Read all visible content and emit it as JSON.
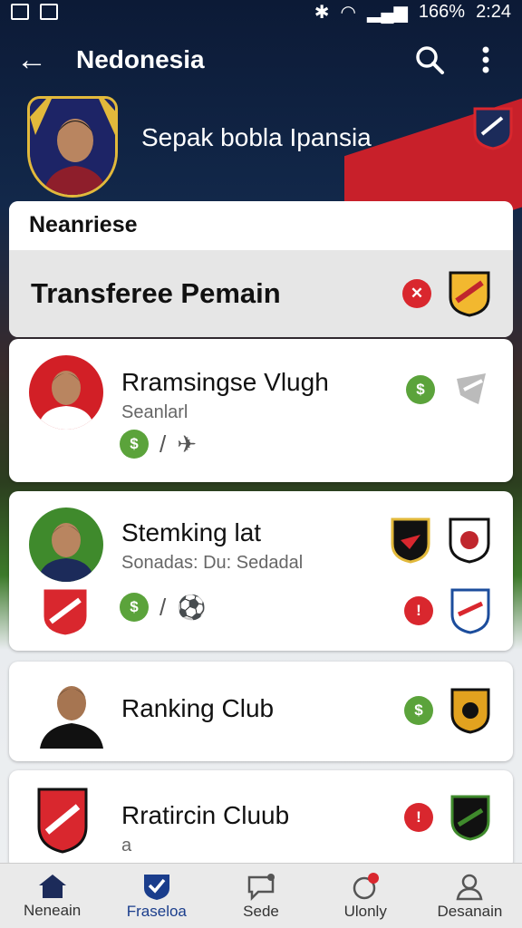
{
  "status_bar": {
    "battery": "166%",
    "time": "2:24"
  },
  "app_bar": {
    "title": "Nedonesia"
  },
  "hero": {
    "title": "Sepak bobla Ipansia"
  },
  "sheet": {
    "header": "Neanriese",
    "row_label": "Transferee Pemain"
  },
  "cards": [
    {
      "name": "Rramsingse Vlugh",
      "sub": "Seanlarl"
    },
    {
      "name": "Stemking lat",
      "sub": "Sonadas: Du: Sedadal"
    },
    {
      "name": "Ranking Club"
    },
    {
      "name": "Rratircin Cluub",
      "sub": "a"
    }
  ],
  "bottom_nav": [
    {
      "label": "Neneain",
      "icon": "home-icon"
    },
    {
      "label": "Fraseloa",
      "icon": "shield-check-icon"
    },
    {
      "label": "Sede",
      "icon": "chat-icon"
    },
    {
      "label": "Ulonly",
      "icon": "notification-icon"
    },
    {
      "label": "Desanain",
      "icon": "profile-icon"
    }
  ],
  "colors": {
    "accent_green": "#5ba33b",
    "accent_red": "#d9272e",
    "nav_active": "#1a3d8c",
    "header_navy": "#0c1a36"
  }
}
